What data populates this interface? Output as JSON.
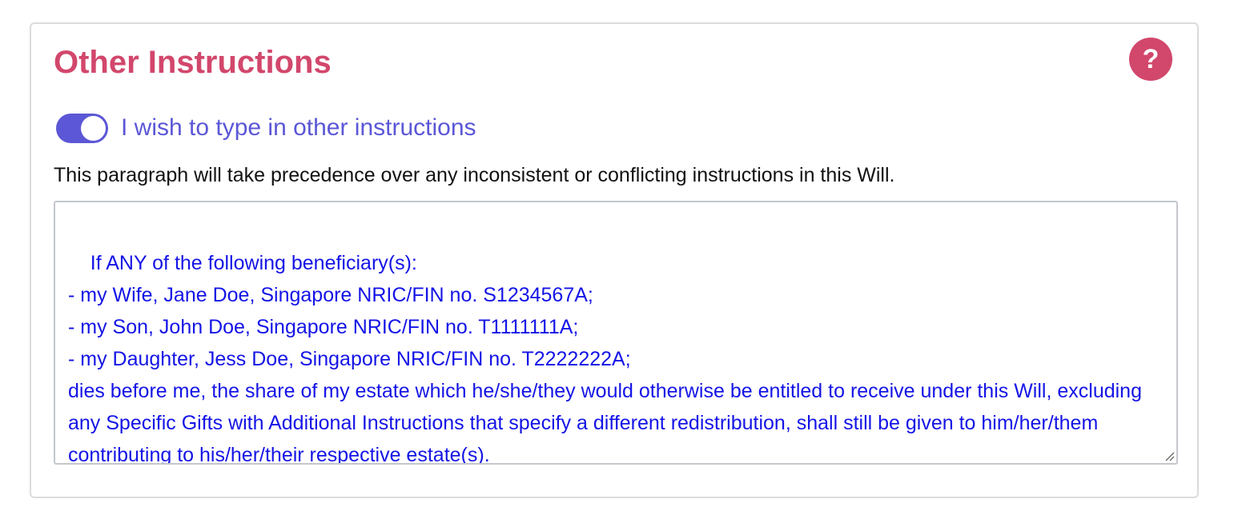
{
  "card": {
    "title": "Other Instructions",
    "help_symbol": "?"
  },
  "toggle": {
    "state": "on",
    "label": "I wish to type in other instructions"
  },
  "note": "This paragraph will take precedence over any inconsistent or conflicting instructions in this Will.",
  "instructions": {
    "value": "If ANY of the following beneficiary(s):\n- my Wife, Jane Doe, Singapore NRIC/FIN no. S1234567A;\n- my Son, John Doe, Singapore NRIC/FIN no. T1111111A;\n- my Daughter, Jess Doe, Singapore NRIC/FIN no. T2222222A;\ndies before me, the share of my estate which he/she/they would otherwise be entitled to receive under this Will, excluding any Specific Gifts with Additional Instructions that specify a different redistribution, shall still be given to him/her/them contributing to his/her/their respective estate(s)."
  },
  "colors": {
    "accent": "#d2476c",
    "toggle": "#5b57d6",
    "input_text": "#1414e6"
  },
  "icons": {
    "help": "question-mark-icon",
    "resize": "resize-grip-icon"
  }
}
